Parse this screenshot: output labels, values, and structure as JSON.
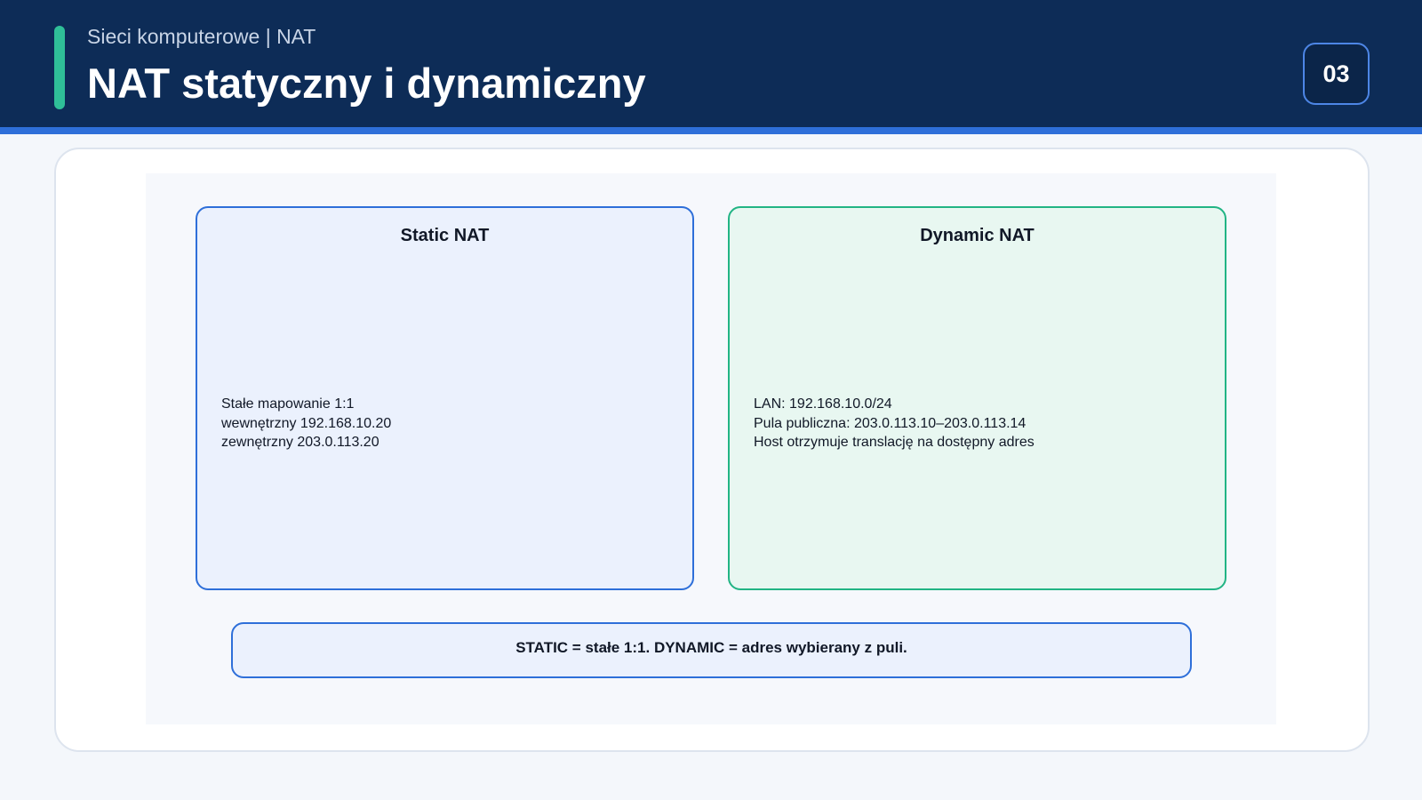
{
  "header": {
    "subtitle": "Sieci komputerowe | NAT",
    "title": "NAT statyczny i dynamiczny",
    "page_number": "03"
  },
  "colors": {
    "header_bg": "#0d2c57",
    "accent_green": "#2fbf98",
    "accent_blue": "#2e6fd9",
    "static_fill": "#ebf1fd",
    "dynamic_border": "#22b484",
    "dynamic_fill": "#e8f7f1"
  },
  "diagram": {
    "static_panel": {
      "title": "Static NAT",
      "lines": [
        "Stałe mapowanie 1:1",
        "wewnętrzny 192.168.10.20",
        "zewnętrzny 203.0.113.20"
      ]
    },
    "dynamic_panel": {
      "title": "Dynamic NAT",
      "lines": [
        "LAN: 192.168.10.0/24",
        "Pula publiczna: 203.0.113.10–203.0.113.14",
        "Host otrzymuje translację na dostępny adres"
      ]
    },
    "summary": "STATIC = stałe 1:1. DYNAMIC = adres wybierany z puli."
  }
}
